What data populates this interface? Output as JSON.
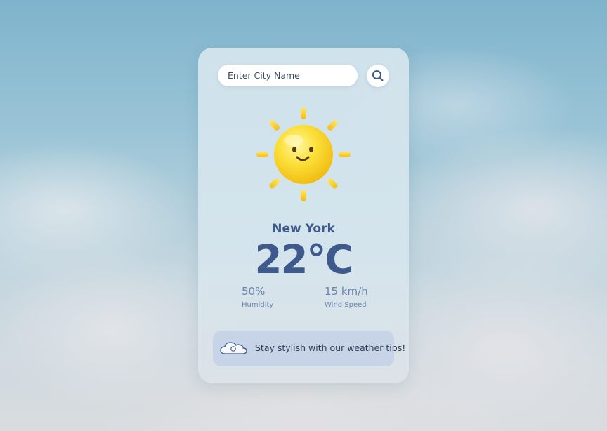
{
  "search": {
    "placeholder": "Enter City Name",
    "value": ""
  },
  "weather": {
    "city": "New York",
    "temperature": "22°C",
    "humidity": {
      "value": "50%",
      "label": "Humidity"
    },
    "wind": {
      "value": "15 km/h",
      "label": "Wind Speed"
    }
  },
  "tip": {
    "text": "Stay stylish with our weather tips!"
  },
  "icons": {
    "search": "search-icon",
    "condition": "sun-icon",
    "tip": "cloud-icon"
  },
  "colors": {
    "accent": "#3e5a8d",
    "secondary": "#6d86b0",
    "sun": "#f7d21c"
  }
}
